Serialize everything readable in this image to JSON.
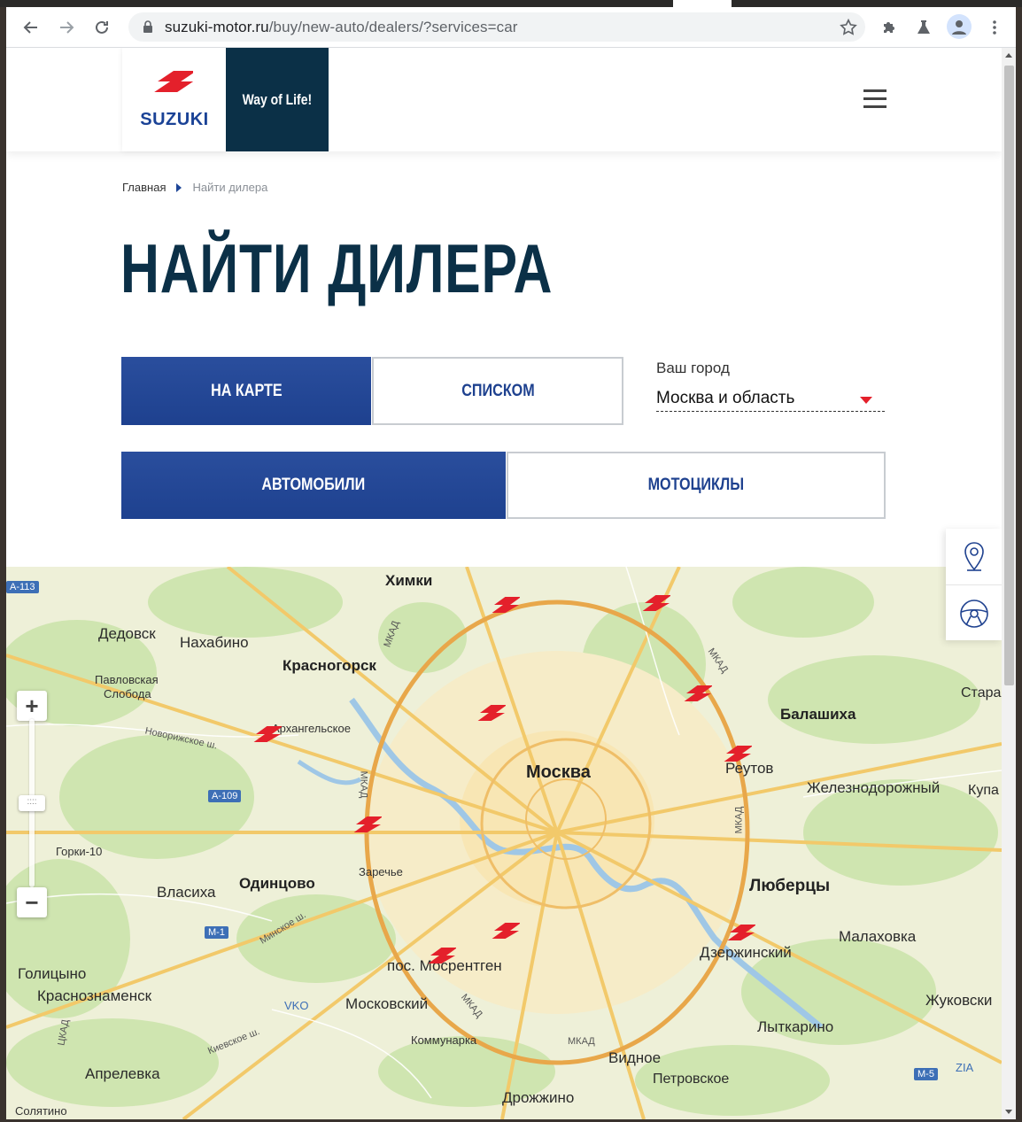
{
  "browser": {
    "url_domain": "suzuki-motor.ru",
    "url_path": "/buy/new-auto/dealers/?services=car"
  },
  "header": {
    "logo_text": "SUZUKI",
    "slogan": "Way of Life!",
    "brand_color": "#0b3047",
    "accent_color": "#e4202b"
  },
  "breadcrumb": {
    "home": "Главная",
    "current": "Найти дилера"
  },
  "page_title": "НАЙТИ ДИЛЕРА",
  "view_toggle": {
    "map_label": "НА КАРТЕ",
    "list_label": "СПИСКОМ",
    "active": "map"
  },
  "vehicle_toggle": {
    "cars_label": "АВТОМОБИЛИ",
    "moto_label": "МОТОЦИКЛЫ",
    "active": "cars"
  },
  "city": {
    "label": "Ваш город",
    "value": "Москва и область"
  },
  "map": {
    "zoom_in": "+",
    "zoom_out": "−",
    "zoom_handle": "::::",
    "labels": {
      "moscow": "Москва",
      "khimki": "Химки",
      "dedovsk": "Дедовск",
      "nakhabino": "Нахабино",
      "krasnogorsk": "Красногорск",
      "pavlovskaya": "Павловская",
      "sloboda": "Слобода",
      "arkhangelskoe": "Архангельское",
      "novorizhskoe": "Новорижское ш.",
      "balashikha": "Балашиха",
      "reutov": "Реутов",
      "zheleznodorozhny": "Железнодорожный",
      "kupa": "Купа",
      "stara": "Стара",
      "gorki10": "Горки-10",
      "vlasikha": "Власиха",
      "odintsovo": "Одинцово",
      "zarechye": "Заречье",
      "lyubertsy": "Люберцы",
      "malakhovka": "Малаховка",
      "dzerzhinsky": "Дзержинский",
      "golitsyno": "Голицыно",
      "krasnoznamensk": "Краснознаменск",
      "vko": "VKO",
      "moskovsky": "Московский",
      "mosrentgen": "пос. Мосрентген",
      "kommunarka": "Коммунарка",
      "vidnoe": "Видное",
      "petrovskoe": "Петровское",
      "zhukovsky": "Жуковски",
      "lytkarino": "Лыткарино",
      "zia": "ZIA",
      "aprelevka": "Апрелевка",
      "drozhzhino": "Дрожжино",
      "minskoe": "Минское ш.",
      "kievskoe": "Киевское ш.",
      "solyatino": "Солятино"
    },
    "roads": {
      "a113": "А-113",
      "a109": "А-109",
      "m1": "М-1",
      "m5": "М-5",
      "mkad": "МКАД",
      "tskad": "ЦКАД"
    }
  }
}
